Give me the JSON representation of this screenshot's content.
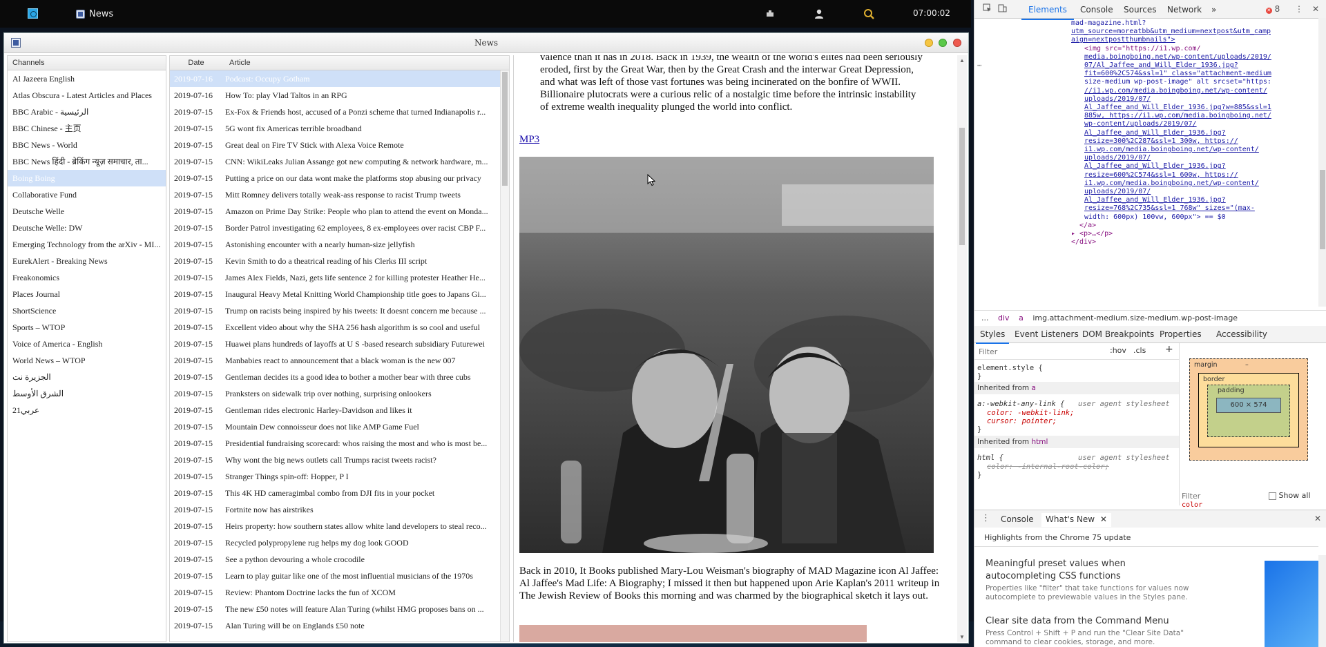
{
  "taskbar": {
    "window_label": "News",
    "clock": "07:00:02"
  },
  "window": {
    "title": "News"
  },
  "channels": {
    "header": "Channels",
    "items": [
      "Al Jazeera English",
      "Atlas Obscura - Latest Articles and Places",
      "BBC Arabic - الرئيسية",
      "BBC Chinese - 主页",
      "BBC News - World",
      "BBC News हिंदी - ब्रेकिंग न्यूज़ समाचार, ता...",
      "Boing Boing",
      "Collaborative Fund",
      "Deutsche Welle",
      "Deutsche Welle: DW",
      "Emerging Technology from the arXiv - MI...",
      "EurekAlert - Breaking News",
      "Freakonomics",
      "Places Journal",
      "ShortScience",
      "Sports – WTOP",
      "Voice of America - English",
      "World News – WTOP",
      "الجزيرة نت",
      "الشرق الأوسط",
      "عربي21"
    ],
    "selected_index": 6
  },
  "articles": {
    "header_date": "Date",
    "header_article": "Article",
    "rows": [
      {
        "date": "2019-07-16",
        "title": "Podcast: Occupy Gotham"
      },
      {
        "date": "2019-07-16",
        "title": "How To: play Vlad Taltos in an RPG"
      },
      {
        "date": "2019-07-15",
        "title": "Ex-Fox & Friends host, accused of a Ponzi scheme that turned Indianapolis r..."
      },
      {
        "date": "2019-07-15",
        "title": "5G wont fix Americas terrible broadband"
      },
      {
        "date": "2019-07-15",
        "title": "Great deal on Fire TV Stick with Alexa Voice Remote"
      },
      {
        "date": "2019-07-15",
        "title": "CNN: WikiLeaks Julian Assange got new computing & network hardware, m..."
      },
      {
        "date": "2019-07-15",
        "title": "Putting a price on our data wont make the platforms stop abusing our privacy"
      },
      {
        "date": "2019-07-15",
        "title": "Mitt Romney delivers totally weak-ass response to racist Trump tweets"
      },
      {
        "date": "2019-07-15",
        "title": "Amazon on Prime Day Strike: People who plan to attend the event on Monda..."
      },
      {
        "date": "2019-07-15",
        "title": "Border Patrol investigating 62 employees, 8 ex-employees over racist CBP F..."
      },
      {
        "date": "2019-07-15",
        "title": "Astonishing encounter with a nearly human-size jellyfish"
      },
      {
        "date": "2019-07-15",
        "title": "Kevin Smith to do a theatrical reading of his Clerks III script"
      },
      {
        "date": "2019-07-15",
        "title": "James Alex Fields, Nazi, gets life sentence 2 for killing protester Heather He..."
      },
      {
        "date": "2019-07-15",
        "title": "Inaugural Heavy Metal Knitting World Championship title goes to Japans Gi..."
      },
      {
        "date": "2019-07-15",
        "title": "Trump on racists being inspired by his tweets: It doesnt concern me because ..."
      },
      {
        "date": "2019-07-15",
        "title": "Excellent video about why the SHA 256 hash algorithm is so cool and useful"
      },
      {
        "date": "2019-07-15",
        "title": "Huawei plans hundreds of layoffs at U S -based research subsidiary Futurewei"
      },
      {
        "date": "2019-07-15",
        "title": "Manbabies react to announcement that a black woman is the new 007"
      },
      {
        "date": "2019-07-15",
        "title": "Gentleman decides its a good idea to bother a mother bear with three cubs"
      },
      {
        "date": "2019-07-15",
        "title": "Pranksters on sidewalk trip over nothing, surprising onlookers"
      },
      {
        "date": "2019-07-15",
        "title": "Gentleman rides electronic Harley-Davidson and likes it"
      },
      {
        "date": "2019-07-15",
        "title": "Mountain Dew connoisseur does not like AMP Game Fuel"
      },
      {
        "date": "2019-07-15",
        "title": "Presidential fundraising scorecard: whos raising the most and who is most be..."
      },
      {
        "date": "2019-07-15",
        "title": "Why wont the big news outlets call Trumps racist tweets racist?"
      },
      {
        "date": "2019-07-15",
        "title": "Stranger Things spin-off: Hopper, P I"
      },
      {
        "date": "2019-07-15",
        "title": "This 4K HD cameragimbal combo from DJI fits in your pocket"
      },
      {
        "date": "2019-07-15",
        "title": "Fortnite now has airstrikes"
      },
      {
        "date": "2019-07-15",
        "title": "Heirs property: how southern states allow white land developers to steal reco..."
      },
      {
        "date": "2019-07-15",
        "title": "Recycled polypropylene rug helps my dog look GOOD"
      },
      {
        "date": "2019-07-15",
        "title": "See a python devouring a whole crocodile"
      },
      {
        "date": "2019-07-15",
        "title": "Learn to play guitar like one of the most influential musicians of the 1970s"
      },
      {
        "date": "2019-07-15",
        "title": "Review: Phantom Doctrine lacks the fun of XCOM"
      },
      {
        "date": "2019-07-15",
        "title": "The new £50 notes will feature Alan Turing (whilst HMG proposes bans on ..."
      },
      {
        "date": "2019-07-15",
        "title": "Alan Turing will be on Englands £50 note"
      }
    ],
    "selected_index": 0
  },
  "reader": {
    "para_top": "valence than it has in 2018. Back in 1939, the wealth of the world's elites had been seriously eroded, first by the Great War, then by the Great Crash and the interwar Great Depression, and what was left of those vast fortunes was being incinerated on the bonfire of WWII. Billionaire plutocrats were a curious relic of a nostalgic time before the intrinsic instability of extreme wealth inequality plunged the world into conflict.",
    "mp3_label": "MP3",
    "para_bottom": "Back in 2010, It Books published Mary-Lou Weisman's biography of MAD Magazine icon Al Jaffee: Al Jaffee's Mad Life: A Biography; I missed it then but happened upon Arie Kaplan's 2011 writeup in The Jewish Review of Books this morning and was charmed by the biographical sketch it lays out."
  },
  "devtools": {
    "tabs": [
      "Elements",
      "Console",
      "Sources",
      "Network"
    ],
    "active_tab": "Elements",
    "more_tabs": "»",
    "error_count": "8",
    "dom_lines": [
      {
        "indent": 0,
        "text": "mad-magazine.html?",
        "cls": "attr-val"
      },
      {
        "indent": 0,
        "text": "utm_source=moreatbb&utm_medium=nextpost&utm_camp",
        "cls": "link-val"
      },
      {
        "indent": 0,
        "text": "aign=nextpostthumbnails\">",
        "cls": "link-val"
      },
      {
        "indent": 1,
        "text": "<img src=\"https://i1.wp.com/",
        "cls": "tag"
      },
      {
        "indent": 1,
        "text": "media.boingboing.net/wp-content/uploads/2019/",
        "cls": "link-val"
      },
      {
        "indent": 1,
        "text": "07/Al_Jaffee_and_Will_Elder_1936.jpg?",
        "cls": "link-val"
      },
      {
        "indent": 1,
        "text": "fit=600%2C574&ssl=1\" class=\"attachment-medium",
        "cls": "link-val"
      },
      {
        "indent": 1,
        "text": "size-medium wp-post-image\" alt srcset=\"https:",
        "cls": "attr-val"
      },
      {
        "indent": 1,
        "text": "//i1.wp.com/media.boingboing.net/wp-content/",
        "cls": "link-val"
      },
      {
        "indent": 1,
        "text": "uploads/2019/07/",
        "cls": "link-val"
      },
      {
        "indent": 1,
        "text": "Al_Jaffee_and_Will_Elder_1936.jpg?w=885&ssl=1",
        "cls": "link-val"
      },
      {
        "indent": 1,
        "text": "885w, https://i1.wp.com/media.boingboing.net/",
        "cls": "link-val"
      },
      {
        "indent": 1,
        "text": "wp-content/uploads/2019/07/",
        "cls": "link-val"
      },
      {
        "indent": 1,
        "text": "Al_Jaffee_and_Will_Elder_1936.jpg?",
        "cls": "link-val"
      },
      {
        "indent": 1,
        "text": "resize=300%2C287&ssl=1 300w, https://",
        "cls": "link-val"
      },
      {
        "indent": 1,
        "text": "i1.wp.com/media.boingboing.net/wp-content/",
        "cls": "link-val"
      },
      {
        "indent": 1,
        "text": "uploads/2019/07/",
        "cls": "link-val"
      },
      {
        "indent": 1,
        "text": "Al_Jaffee_and_Will_Elder_1936.jpg?",
        "cls": "link-val"
      },
      {
        "indent": 1,
        "text": "resize=600%2C574&ssl=1 600w, https://",
        "cls": "link-val"
      },
      {
        "indent": 1,
        "text": "i1.wp.com/media.boingboing.net/wp-content/",
        "cls": "link-val"
      },
      {
        "indent": 1,
        "text": "uploads/2019/07/",
        "cls": "link-val"
      },
      {
        "indent": 1,
        "text": "Al_Jaffee_and_Will_Elder_1936.jpg?",
        "cls": "link-val"
      },
      {
        "indent": 1,
        "text": "resize=768%2C735&ssl=1 768w\" sizes=\"(max-",
        "cls": "link-val"
      },
      {
        "indent": 1,
        "text": "width: 600px) 100vw, 600px\"> == $0",
        "cls": "attr-val"
      },
      {
        "indent": 0,
        "text": "  </a>",
        "cls": "tag"
      },
      {
        "indent": 0,
        "text": "▸ <p>…</p>",
        "cls": "tag"
      },
      {
        "indent": 0,
        "text": "</div>",
        "cls": "tag"
      }
    ],
    "breadcrumbs": [
      "...",
      "div",
      "a",
      "img.attachment-medium.size-medium.wp-post-image"
    ],
    "sub_tabs": [
      "Styles",
      "Event Listeners",
      "DOM Breakpoints",
      "Properties",
      "Accessibility"
    ],
    "styles": {
      "filter_placeholder": "Filter",
      "hov": ":hov",
      "cls": ".cls",
      "add": "+",
      "element_style": "element.style {",
      "close_brace": "}",
      "inherited_a_prefix": "Inherited from ",
      "inherited_a_tag": "a",
      "rule1_selector": "a:-webkit-any-link {",
      "rule1_source": "user agent stylesheet",
      "rule1_prop1": "color: -webkit-link;",
      "rule1_prop2": "cursor: pointer;",
      "inherited_html_tag": "html",
      "rule2_selector": "html {",
      "rule2_source": "user agent stylesheet",
      "rule2_prop1": "color: -internal-root-color;"
    },
    "boxmodel": {
      "margin_label": "margin",
      "border_label": "border",
      "padding_label": "padding",
      "dash": "–",
      "content_size": "600 × 574",
      "filter_placeholder": "Filter",
      "show_all": "Show all",
      "color_prop": "color"
    },
    "drawer": {
      "tabs": [
        "Console",
        "What's New"
      ],
      "active": "What's New",
      "headline": "Highlights from the Chrome 75 update",
      "item1_title": "Meaningful preset values when autocompleting CSS functions",
      "item1_desc": "Properties like \"filter\" that take functions for values now autocomplete to previewable values in the Styles pane.",
      "item2_title": "Clear site data from the Command Menu",
      "item2_desc": "Press Control + Shift + P and run the \"Clear Site Data\" command to clear cookies, storage, and more."
    }
  }
}
